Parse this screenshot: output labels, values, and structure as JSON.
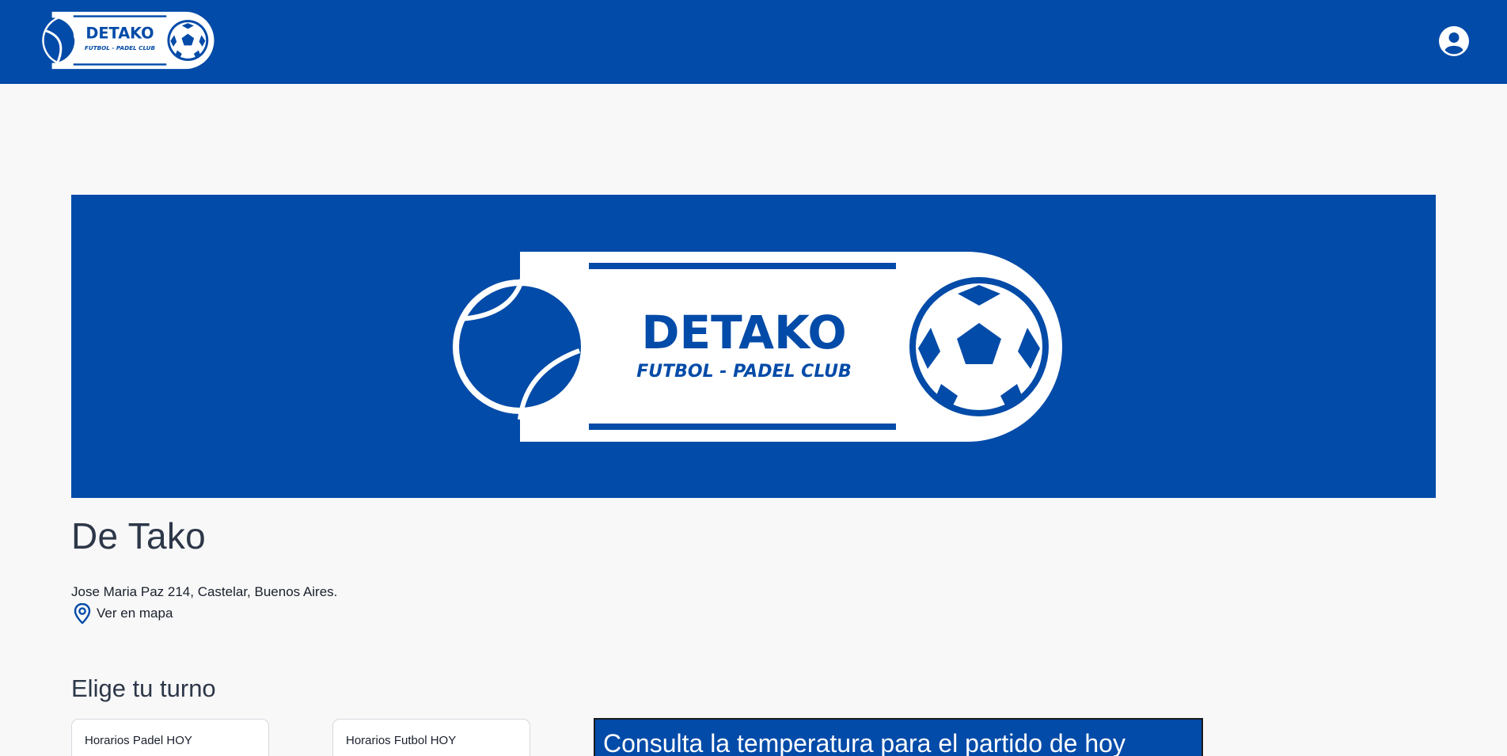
{
  "brand": {
    "name": "DETAKO",
    "tagline": "FUTBOL - PADEL CLUB",
    "color": "#034ba8"
  },
  "header": {
    "avatar_icon": "user-circle-icon"
  },
  "hero": {
    "logo_name": "DETAKO",
    "logo_tagline": "FUTBOL - PADEL CLUB"
  },
  "club": {
    "name": "De Tako",
    "address": "Jose Maria Paz 214, Castelar, Buenos Aires.",
    "map_label": "Ver en mapa",
    "map_icon": "map-pin-icon"
  },
  "booking": {
    "title": "Elige tu turno",
    "cards": [
      {
        "label": "Horarios Padel HOY"
      },
      {
        "label": "Horarios Futbol HOY"
      }
    ],
    "weather_label": "Consulta la temperatura para el partido de hoy"
  }
}
